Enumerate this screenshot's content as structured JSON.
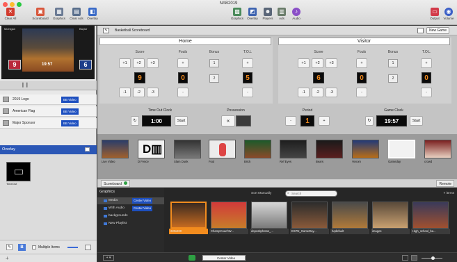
{
  "window": {
    "title": "NAB2019"
  },
  "toolbar": {
    "clear_all": "Clear All",
    "scoreboard": "Scoreboard",
    "graphics": "Graphics",
    "clear_ads": "Clear Ads",
    "overlay": "Overlay",
    "graphics_r": "Graphics",
    "overlay_r": "Overlay",
    "players": "Players",
    "ads": "Ads",
    "audio": "Audio",
    "output": "Output",
    "volume": "Volume"
  },
  "preview": {
    "home_team": "Michigan",
    "visitor_team": "Baylor",
    "home_score": "9",
    "visitor_score": "6",
    "clock": "19:57"
  },
  "playlist": {
    "items": [
      {
        "label": "2019 Logo",
        "tag": "BB Video"
      },
      {
        "label": "American Flag",
        "tag": "BB Video"
      },
      {
        "label": "Major Sponsor",
        "tag": "BB Video"
      }
    ]
  },
  "overlay": {
    "header": "Overlay",
    "thumb_label": "TimeOut"
  },
  "left_footer": {
    "multiple_items": "Multiple Items"
  },
  "board": {
    "title": "Basketball Scoreboard",
    "new_game": "New Game",
    "home": {
      "name": "Home",
      "score": "9",
      "fouls": "0",
      "bonus_top": "1",
      "bonus_bottom": "2",
      "tol": "5",
      "score_label": "Score",
      "fouls_label": "Fouls",
      "bonus_label": "Bonus",
      "tol_label": "T.O.L"
    },
    "visitor": {
      "name": "Visitor",
      "score": "6",
      "fouls": "0",
      "bonus_top": "1",
      "bonus_bottom": "2",
      "tol": "0",
      "score_label": "Score",
      "fouls_label": "Fouls",
      "bonus_label": "Bonus",
      "tol_label": "T.O.L"
    },
    "buttons": {
      "p1": "+1",
      "p2": "+2",
      "p3": "+3",
      "m1": "-1",
      "m2": "-2",
      "m3": "-3",
      "plus": "+",
      "minus": "-"
    },
    "timeout": {
      "label": "Time Out Clock",
      "value": "1:00",
      "start": "Start"
    },
    "possession": {
      "label": "Possession",
      "arrow": "«"
    },
    "period": {
      "label": "Period",
      "value": "1"
    },
    "game_clock": {
      "label": "Game Clock",
      "value": "19:57",
      "start": "Start"
    }
  },
  "strip": {
    "items": [
      "Live Video",
      "D Fence",
      "Slam Dunk",
      "Foul",
      "Brick",
      "Ref Eyes",
      "Bears",
      "Venom",
      "Gameday",
      "crowd"
    ],
    "crowd": "crowd"
  },
  "scoreboard_tab": {
    "label": "Scoreboard",
    "remote": "Remote"
  },
  "media": {
    "heading": "Graphics",
    "sort": "Sort Manually",
    "search_placeholder": "Search",
    "count": "7 items",
    "sidebar": [
      {
        "label": "Media",
        "tag": "Center Video"
      },
      {
        "label": "With Audio",
        "tag": "Center Video"
      },
      {
        "label": "backgrounds",
        "tag": ""
      },
      {
        "label": "New Playlist",
        "tag": ""
      }
    ],
    "thumbs": [
      "220x220",
      "ChampCoachW...",
      "depositphotos_...",
      "ESPN_GameDay...",
      "hqdefault",
      "images",
      "High_school_ba..."
    ],
    "footer_select": "Center Video"
  }
}
